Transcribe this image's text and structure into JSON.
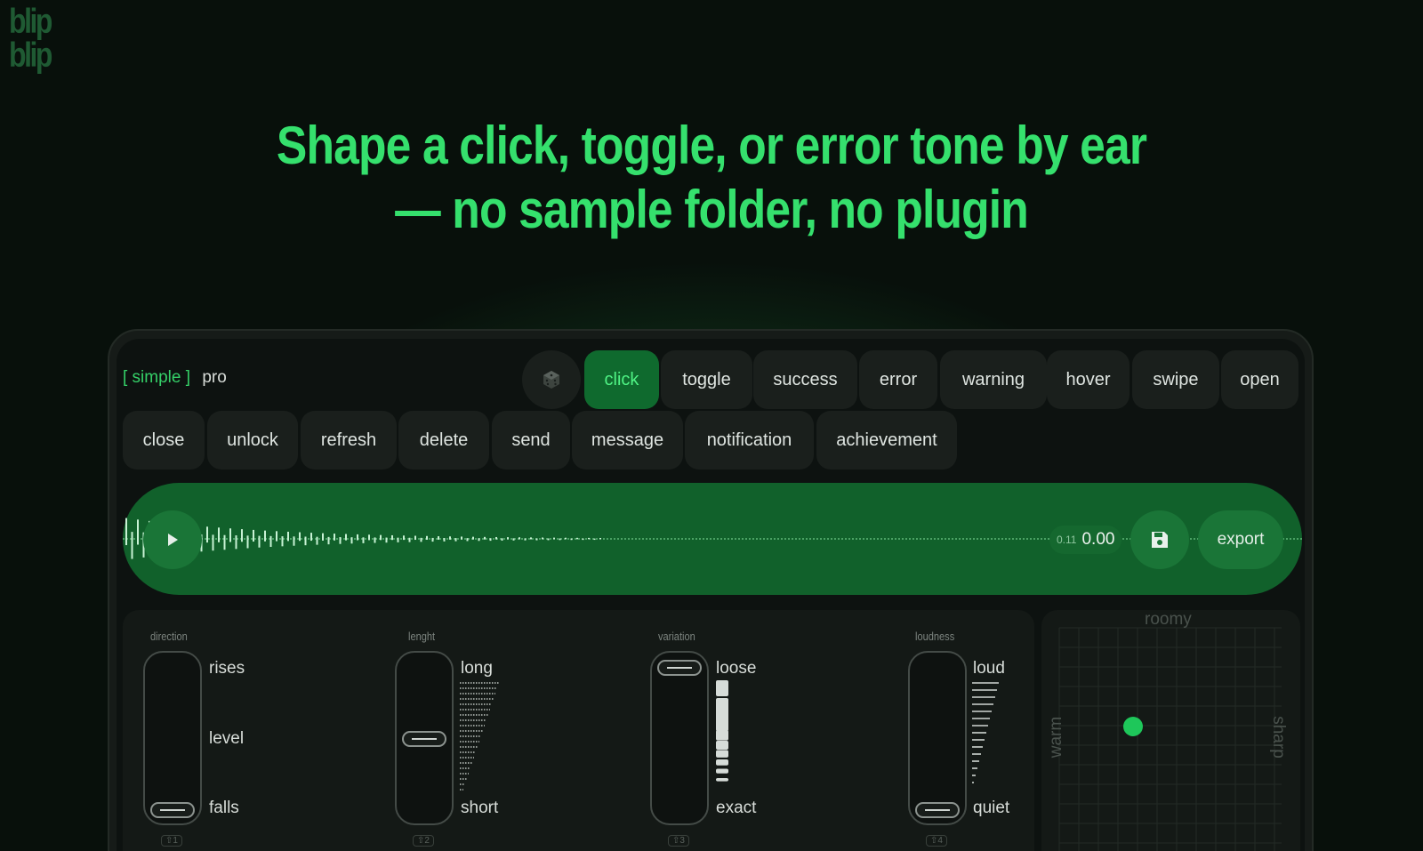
{
  "logo": {
    "line1": "blip",
    "line2": "blip"
  },
  "headline": {
    "line1": "Shape a click, toggle, or error tone by ear",
    "line2": "— no sample folder, no plugin"
  },
  "mode": {
    "selected": "[ simple ]",
    "other": "pro"
  },
  "sounds_row1": [
    "click",
    "toggle",
    "success",
    "error",
    "warning",
    "hover",
    "swipe",
    "open"
  ],
  "sounds_row2": [
    "close",
    "unlock",
    "refresh",
    "delete",
    "send",
    "message",
    "notification",
    "achievement"
  ],
  "active_sound": "click",
  "player": {
    "duration": "0.11",
    "time": "0.00",
    "export_label": "export"
  },
  "controls": {
    "direction": {
      "title": "direction",
      "top": "rises",
      "mid": "level",
      "bottom": "falls",
      "key": "⇧1",
      "value": 0.0
    },
    "length": {
      "title": "lenght",
      "top": "long",
      "bottom": "short",
      "key": "⇧2",
      "value": 0.5
    },
    "variation": {
      "title": "variation",
      "top": "loose",
      "bottom": "exact",
      "key": "⇧3",
      "value": 1.0
    },
    "loudness": {
      "title": "loudness",
      "top": "loud",
      "bottom": "quiet",
      "key": "⇧4",
      "value": 0.0
    }
  },
  "pad": {
    "top": "roomy",
    "left": "warm",
    "right": "sharp"
  },
  "colors": {
    "accent": "#35e06d",
    "player_bg": "#11612b",
    "active_chip": "#0f6a2e"
  }
}
